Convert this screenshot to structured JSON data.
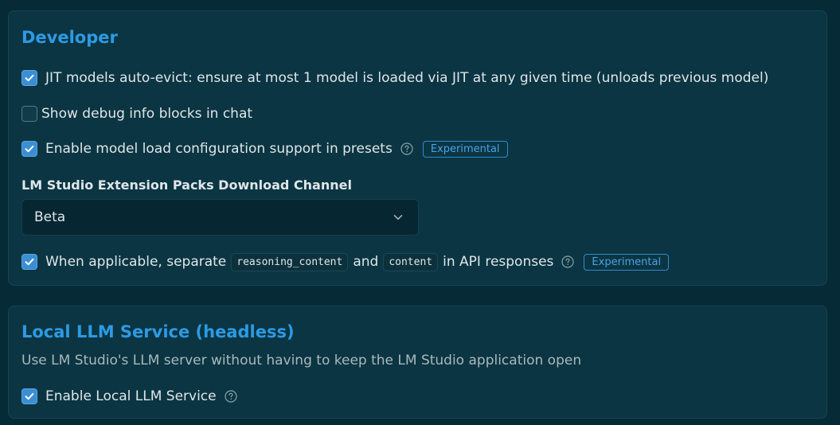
{
  "developer": {
    "title": "Developer",
    "jit_auto_evict": {
      "label": "JIT models auto-evict: ensure at most 1 model is loaded via JIT at any given time (unloads previous model)",
      "checked": true
    },
    "debug_info": {
      "label": "Show debug info blocks in chat",
      "checked": false
    },
    "model_load_config": {
      "label": "Enable model load configuration support in presets",
      "checked": true,
      "badge": "Experimental",
      "help_icon": "question-circle-icon"
    },
    "extension_channel": {
      "label": "LM Studio Extension Packs Download Channel",
      "value": "Beta"
    },
    "separate_reasoning": {
      "text_before": "When applicable, separate",
      "code1": "reasoning_content",
      "text_and": "and",
      "code2": "content",
      "text_after": "in API responses",
      "checked": true,
      "badge": "Experimental",
      "help_icon": "question-circle-icon"
    }
  },
  "local_llm": {
    "title": "Local LLM Service (headless)",
    "description": "Use LM Studio's LLM server without having to keep the LM Studio application open",
    "enable": {
      "label": "Enable Local LLM Service",
      "checked": true,
      "help_icon": "question-circle-icon"
    }
  },
  "colors": {
    "background": "#062a36",
    "card": "#0b3542",
    "accent": "#2d9ae4",
    "checkbox": "#3b8ed3"
  }
}
